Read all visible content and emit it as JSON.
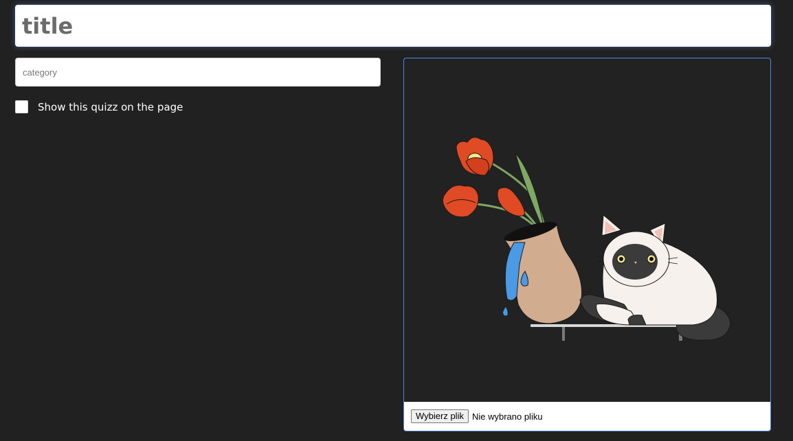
{
  "form": {
    "title_placeholder": "title",
    "category_placeholder": "category",
    "show_checkbox_label": "Show this quizz on the page",
    "show_checkbox_checked": false
  },
  "image_upload": {
    "button_label": "Wybierz plik",
    "status_text": "Nie wybrano pliku",
    "preview_description_icon": "cat-and-vase-illustration"
  },
  "colors": {
    "background": "#212121",
    "focus_glow": "#5a8ce6",
    "panel_border": "#4a8ae6"
  }
}
